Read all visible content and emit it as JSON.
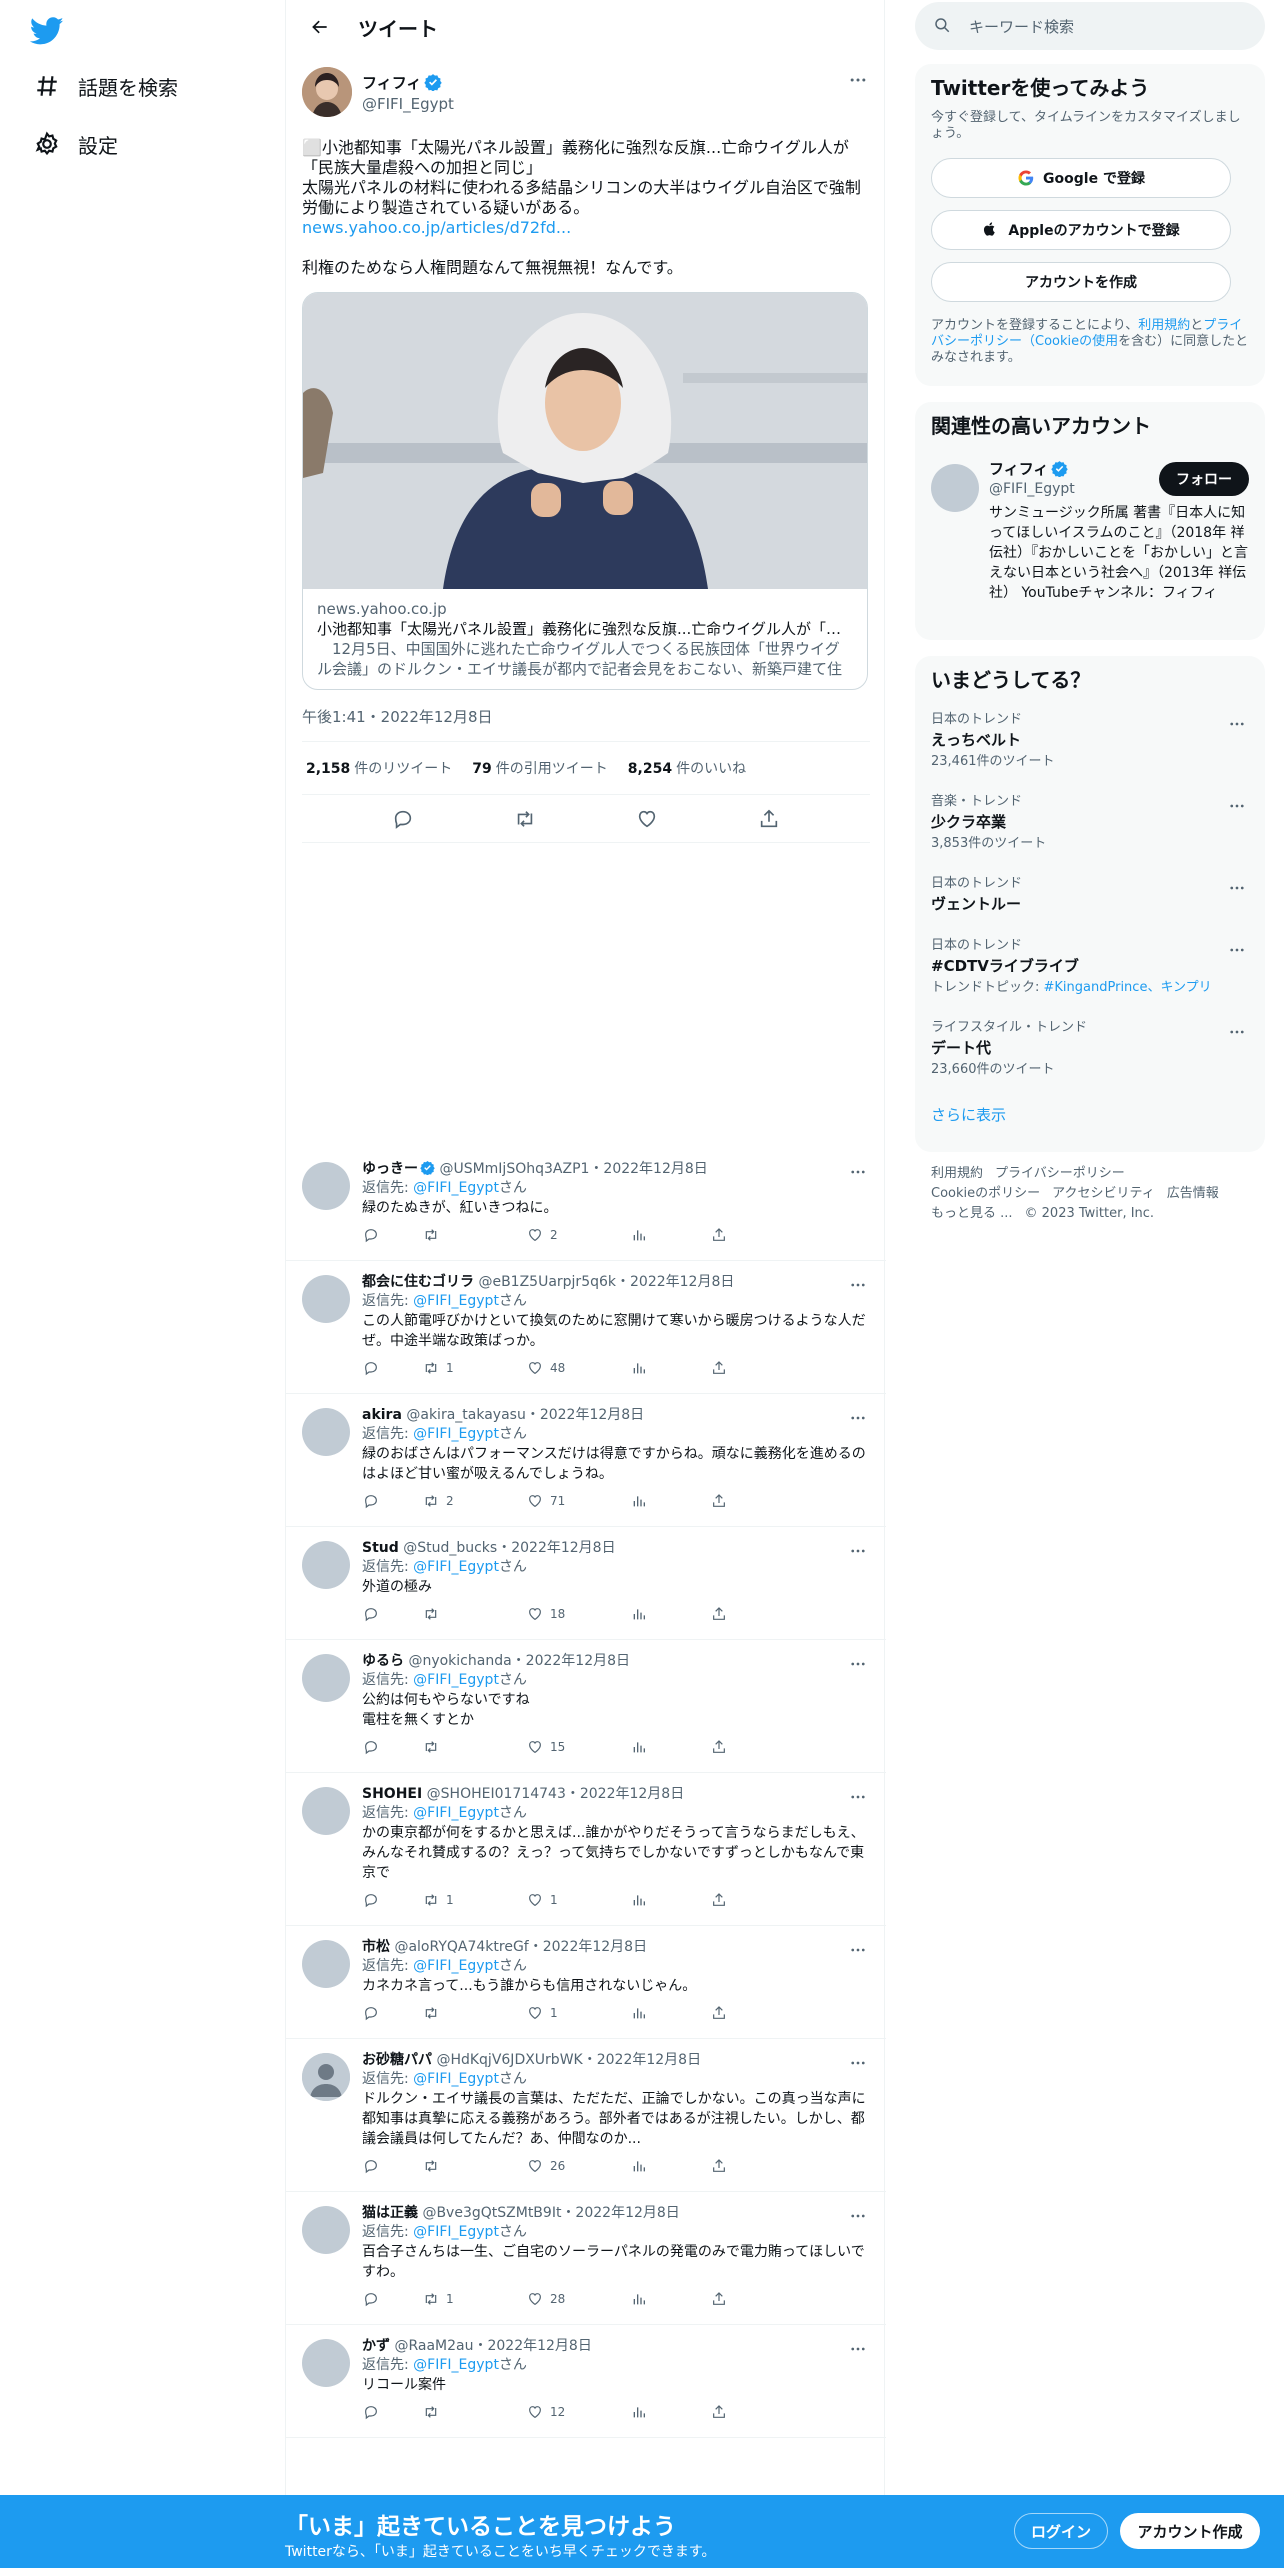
{
  "nav": {
    "explore": "話題を検索",
    "settings": "設定"
  },
  "header": {
    "title": "ツイート"
  },
  "tweet": {
    "name": "フィフィ",
    "handle": "@FIFI_Egypt",
    "line1": "⬜小池都知事「太陽光パネル設置」義務化に強烈な反旗...亡命ウイグル人が「民族大量虐殺への加担と同じ」",
    "line2": "太陽光パネルの材料に使われる多結晶シリコンの大半はウイグル自治区で強制労働により製造されている疑いがある。",
    "link": "news.yahoo.co.jp/articles/d72fd...",
    "line3": "利権のためなら人権問題なんて無視無視！なんです。",
    "card_domain": "news.yahoo.co.jp",
    "card_title": "小池都知事「太陽光パネル設置」義務化に強烈な反旗...亡命ウイグル人が「民...",
    "card_desc": "　12月5日、中国国外に逃れた亡命ウイグル人でつくる民族団体「世界ウイグル会議」のドルクン・エイサ議長が都内で記者会見をおこない、新築戸建て住宅...",
    "time": "午後1:41・2022年12月8日",
    "retweets": "2,158",
    "retweets_label": "件のリツイート",
    "quotes": "79",
    "quotes_label": "件の引用ツイート",
    "likes": "8,254",
    "likes_label": "件のいいね"
  },
  "replies": [
    {
      "name": "ゆっきー",
      "verified": true,
      "handle": "@USMmIjSOhq3AZP1",
      "date": "・2022年12月8日",
      "to_label": "返信先:",
      "to": "@FIFI_Egypt",
      "to_suffix": "さん",
      "text": "緑のたぬきが、紅いきつねに。",
      "retweets": "",
      "likes": "2"
    },
    {
      "name": "都会に住むゴリラ",
      "verified": false,
      "handle": "@eB1Z5Uarpjr5q6k",
      "date": "・2022年12月8日",
      "to_label": "返信先:",
      "to": "@FIFI_Egypt",
      "to_suffix": "さん",
      "text": "この人節電呼びかけといて換気のために窓開けて寒いから暖房つけるような人だぜ。中途半端な政策ばっか。",
      "retweets": "1",
      "likes": "48"
    },
    {
      "name": "akira",
      "verified": false,
      "handle": "@akira_takayasu",
      "date": "・2022年12月8日",
      "to_label": "返信先:",
      "to": "@FIFI_Egypt",
      "to_suffix": "さん",
      "text": "緑のおばさんはパフォーマンスだけは得意ですからね。頑なに義務化を進めるのはよほど甘い蜜が吸えるんでしょうね。",
      "retweets": "2",
      "likes": "71"
    },
    {
      "name": "Stud",
      "verified": false,
      "handle": "@Stud_bucks",
      "date": "・2022年12月8日",
      "to_label": "返信先:",
      "to": "@FIFI_Egypt",
      "to_suffix": "さん",
      "text": "外道の極み",
      "retweets": "",
      "likes": "18"
    },
    {
      "name": "ゆるら",
      "verified": false,
      "handle": "@nyokichanda",
      "date": "・2022年12月8日",
      "to_label": "返信先:",
      "to": "@FIFI_Egypt",
      "to_suffix": "さん",
      "text": "公約は何もやらないですね\n電柱を無くすとか",
      "retweets": "",
      "likes": "15"
    },
    {
      "name": "SHOHEI",
      "verified": false,
      "handle": "@SHOHEI01714743",
      "date": "・2022年12月8日",
      "to_label": "返信先:",
      "to": "@FIFI_Egypt",
      "to_suffix": "さん",
      "text": "かの東京都が何をするかと思えば...誰かがやりだそうって言うならまだしもえ、みんなそれ賛成するの？えっ？って気持ちでしかないですずっとしかもなんで東京で",
      "retweets": "1",
      "likes": "1"
    },
    {
      "name": "市松",
      "verified": false,
      "handle": "@aloRYQA74ktreGf",
      "date": "・2022年12月8日",
      "to_label": "返信先:",
      "to": "@FIFI_Egypt",
      "to_suffix": "さん",
      "text": "カネカネ言って...もう誰からも信用されないじゃん。",
      "retweets": "",
      "likes": "1"
    },
    {
      "name": "お砂糖パパ",
      "verified": false,
      "handle": "@HdKqjV6JDXUrbWK",
      "date": "・2022年12月8日",
      "to_label": "返信先:",
      "to": "@FIFI_Egypt",
      "to_suffix": "さん",
      "text": "ドルクン・エイサ議長の言葉は、ただただ、正論でしかない。この真っ当な声に都知事は真摯に応える義務があろう。部外者ではあるが注視したい。しかし、都議会議員は何してたんだ？あ、仲間なのか...",
      "retweets": "",
      "likes": "26"
    },
    {
      "name": "猫は正義",
      "verified": false,
      "handle": "@Bve3gQtSZMtB9It",
      "date": "・2022年12月8日",
      "to_label": "返信先:",
      "to": "@FIFI_Egypt",
      "to_suffix": "さん",
      "text": "百合子さんちは一生、ご自宅のソーラーパネルの発電のみで電力賄ってほしいですわ。",
      "retweets": "1",
      "likes": "28"
    },
    {
      "name": "かず",
      "verified": false,
      "handle": "@RaaM2au",
      "date": "・2022年12月8日",
      "to_label": "返信先:",
      "to": "@FIFI_Egypt",
      "to_suffix": "さん",
      "text": "リコール案件",
      "retweets": "",
      "likes": "12"
    }
  ],
  "right": {
    "search_placeholder": "キーワード検索",
    "signup": {
      "title": "Twitterを使ってみよう",
      "subtitle": "今すぐ登録して、タイムラインをカスタマイズしましょう。",
      "google": "Google で登録",
      "apple": "Appleのアカウントで登録",
      "create": "アカウントを作成",
      "legal_a": "アカウントを登録することにより、",
      "legal_terms": "利用規約",
      "legal_b": "と",
      "legal_privacy": "プライバシーポリシー（Cookieの使用",
      "legal_c": "を含む）に同意したとみなされます。"
    },
    "relevant": {
      "title": "関連性の高いアカウント",
      "name": "フィフィ",
      "handle": "@FIFI_Egypt",
      "follow": "フォロー",
      "bio": "サンミュージック所属 著書『日本人に知ってほしいイスラムのこと』（2018年 祥伝社）『おかしいことを「おかしい」と言えない日本という社会へ』（2013年 祥伝社） YouTubeチャンネル：フィフィ"
    },
    "trends": {
      "title": "いまどうしてる？",
      "items": [
        {
          "cat": "日本のトレンド",
          "topic": "えっちベルト",
          "count": "23,461件のツイート"
        },
        {
          "cat": "音楽・トレンド",
          "topic": "少クラ卒業",
          "count": "3,853件のツイート"
        },
        {
          "cat": "日本のトレンド",
          "topic": "ヴェントルー",
          "count": ""
        },
        {
          "cat": "日本のトレンド",
          "topic": "#CDTVライブライブ",
          "count_label": "トレンドトピック: ",
          "count_link": "#KingandPrince、キンプリ"
        },
        {
          "cat": "ライフスタイル・トレンド",
          "topic": "デート代",
          "count": "23,660件のツイート"
        }
      ],
      "more": "さらに表示"
    },
    "footer": {
      "terms": "利用規約",
      "privacy": "プライバシーポリシー",
      "cookie": "Cookieのポリシー",
      "access": "アクセシビリティ",
      "ads": "広告情報",
      "more": "もっと見る ...",
      "copy": "© 2023 Twitter, Inc."
    }
  },
  "bottom": {
    "title": "「いま」起きていることを見つけよう",
    "subtitle": "Twitterなら、「いま」起きていることをいち早くチェックできます。",
    "login": "ログイン",
    "signup": "アカウント作成"
  },
  "colors": {
    "accent": "#1d9bf0",
    "text": "#0f1419",
    "muted": "#536471"
  }
}
